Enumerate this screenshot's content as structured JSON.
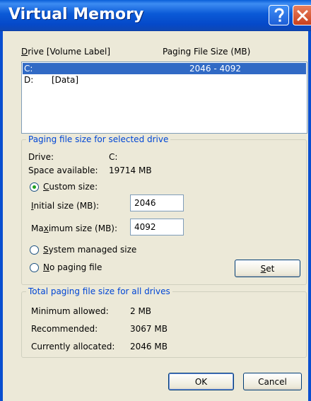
{
  "window": {
    "title": "Virtual Memory",
    "help_button": "?",
    "close_button": "X"
  },
  "drive_list": {
    "col_drive_prefix": "D",
    "col_drive_rest": "rive  [Volume Label]",
    "col_size": "Paging File Size (MB)",
    "rows": [
      {
        "drive": "C:",
        "label": "",
        "size": "2046 - 4092",
        "selected": true
      },
      {
        "drive": "D:",
        "label": "[Data]",
        "size": "",
        "selected": false
      }
    ]
  },
  "selected_drive_group": {
    "title": "Paging file size for selected drive",
    "drive_label": "Drive:",
    "drive_value": "C:",
    "space_label": "Space available:",
    "space_value": "19714 MB",
    "custom_prefix": "C",
    "custom_rest": "ustom size:",
    "initial_prefix": "I",
    "initial_rest": "nitial size (MB):",
    "initial_value": "2046",
    "max_pre": "Ma",
    "max_key": "x",
    "max_rest": "imum size (MB):",
    "max_value": "4092",
    "system_pre": "S",
    "system_key": "y",
    "system_rest": "stem managed size",
    "nopaging_prefix": "N",
    "nopaging_rest": "o paging file",
    "set_prefix": "S",
    "set_rest": "et",
    "selected_option": "custom"
  },
  "total_group": {
    "title": "Total paging file size for all drives",
    "min_label": "Minimum allowed:",
    "min_value": "2 MB",
    "rec_label": "Recommended:",
    "rec_value": "3067 MB",
    "cur_label": "Currently allocated:",
    "cur_value": "2046 MB"
  },
  "buttons": {
    "ok": "OK",
    "cancel": "Cancel"
  },
  "colors": {
    "title_bar": "#0b5ad7",
    "selection": "#316ac5",
    "group_title": "#0046d5",
    "dialog_bg": "#ece9d8"
  }
}
